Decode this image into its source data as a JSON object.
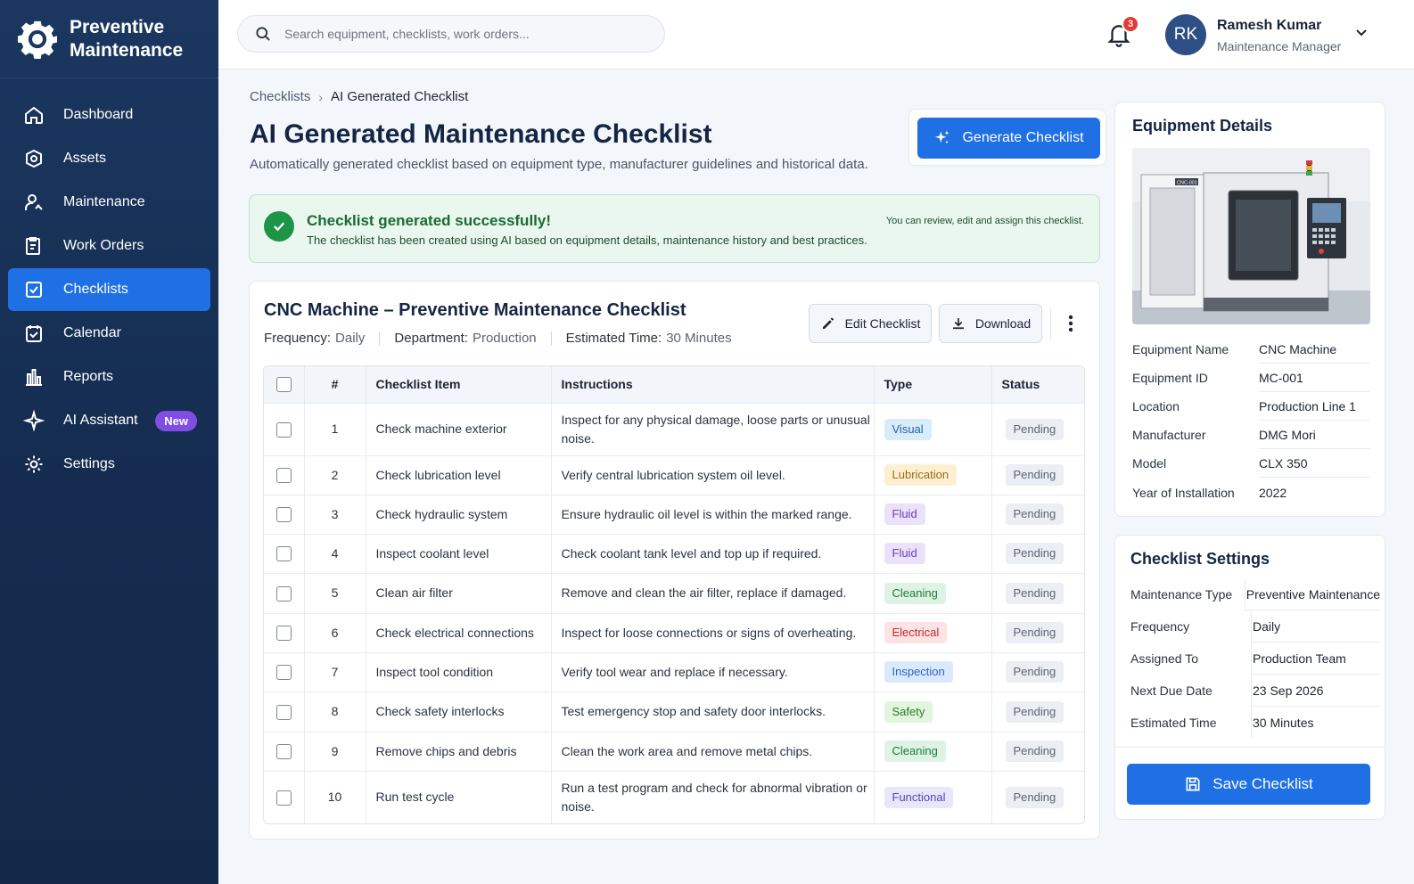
{
  "app": {
    "title_line1": "Preventive",
    "title_line2": "Maintenance"
  },
  "sidebar": {
    "items": [
      {
        "label": "Dashboard",
        "icon": "home-icon"
      },
      {
        "label": "Assets",
        "icon": "assets-icon"
      },
      {
        "label": "Maintenance",
        "icon": "user-wrench-icon"
      },
      {
        "label": "Work Orders",
        "icon": "clipboard-icon"
      },
      {
        "label": "Checklists",
        "icon": "checkbox-icon",
        "active": true
      },
      {
        "label": "Calendar",
        "icon": "calendar-icon"
      },
      {
        "label": "Reports",
        "icon": "bar-chart-icon"
      },
      {
        "label": "AI Assistant",
        "icon": "sparkle-icon",
        "badge": "New"
      },
      {
        "label": "Settings",
        "icon": "gear-icon"
      }
    ]
  },
  "topbar": {
    "search_placeholder": "Search equipment, checklists, work orders...",
    "notification_count": "3",
    "user_initials": "RK",
    "user_name": "Ramesh Kumar",
    "user_role": "Maintenance Manager"
  },
  "breadcrumb": {
    "parent": "Checklists",
    "current": "AI Generated Checklist"
  },
  "page": {
    "title": "AI Generated Maintenance Checklist",
    "subtitle": "Automatically generated checklist based on equipment type, manufacturer guidelines and historical data.",
    "generate_label": "Generate Checklist"
  },
  "alert": {
    "title": "Checklist generated successfully!",
    "text": "The checklist has been created using AI based on equipment details, maintenance history and best practices.",
    "hint": "You can review, edit and assign this checklist."
  },
  "checklist": {
    "title": "CNC Machine – Preventive Maintenance Checklist",
    "frequency_label": "Frequency:",
    "frequency_value": "Daily",
    "department_label": "Department:",
    "department_value": "Production",
    "time_label": "Estimated Time:",
    "time_value": "30 Minutes",
    "edit_label": "Edit Checklist",
    "download_label": "Download",
    "columns": [
      "#",
      "Checklist Item",
      "Instructions",
      "Type",
      "Status"
    ],
    "rows": [
      {
        "num": "1",
        "item": "Check machine exterior",
        "instructions": "Inspect for any physical damage, loose parts or unusual noise.",
        "type": "Visual",
        "status": "Pending"
      },
      {
        "num": "2",
        "item": "Check lubrication level",
        "instructions": "Verify central lubrication system oil level.",
        "type": "Lubrication",
        "status": "Pending"
      },
      {
        "num": "3",
        "item": "Check hydraulic system",
        "instructions": "Ensure hydraulic oil level is within the marked range.",
        "type": "Fluid",
        "status": "Pending"
      },
      {
        "num": "4",
        "item": "Inspect coolant level",
        "instructions": "Check coolant tank level and top up if required.",
        "type": "Fluid",
        "status": "Pending"
      },
      {
        "num": "5",
        "item": "Clean air filter",
        "instructions": "Remove and clean the air filter, replace if damaged.",
        "type": "Cleaning",
        "status": "Pending"
      },
      {
        "num": "6",
        "item": "Check electrical connections",
        "instructions": "Inspect for loose connections or signs of overheating.",
        "type": "Electrical",
        "status": "Pending"
      },
      {
        "num": "7",
        "item": "Inspect tool condition",
        "instructions": "Verify tool wear and replace if necessary.",
        "type": "Inspection",
        "status": "Pending"
      },
      {
        "num": "8",
        "item": "Check safety interlocks",
        "instructions": "Test emergency stop and safety door interlocks.",
        "type": "Safety",
        "status": "Pending"
      },
      {
        "num": "9",
        "item": "Remove chips and debris",
        "instructions": "Clean the work area and remove metal chips.",
        "type": "Cleaning",
        "status": "Pending"
      },
      {
        "num": "10",
        "item": "Run test cycle",
        "instructions": "Run a test program and check for abnormal vibration or noise.",
        "type": "Functional",
        "status": "Pending"
      }
    ]
  },
  "equipment": {
    "title": "Equipment Details",
    "photo_label": "CNC-001",
    "fields": [
      {
        "label": "Equipment Name",
        "value": "CNC Machine"
      },
      {
        "label": "Equipment ID",
        "value": "MC-001"
      },
      {
        "label": "Location",
        "value": "Production Line 1"
      },
      {
        "label": "Manufacturer",
        "value": "DMG Mori"
      },
      {
        "label": "Model",
        "value": "CLX 350"
      },
      {
        "label": "Year of Installation",
        "value": "2022"
      }
    ]
  },
  "settings": {
    "title": "Checklist Settings",
    "fields": [
      {
        "label": "Maintenance Type",
        "value": "Preventive Maintenance"
      },
      {
        "label": "Frequency",
        "value": "Daily"
      },
      {
        "label": "Assigned To",
        "value": "Production Team"
      },
      {
        "label": "Next Due Date",
        "value": "23 Sep 2026"
      },
      {
        "label": "Estimated Time",
        "value": "30 Minutes"
      }
    ],
    "save_label": "Save Checklist"
  },
  "colors": {
    "accent": "#1f6fe5",
    "sidebar": "#1b3760",
    "success": "#1e9447",
    "badge_new": "#7e4ee3"
  }
}
